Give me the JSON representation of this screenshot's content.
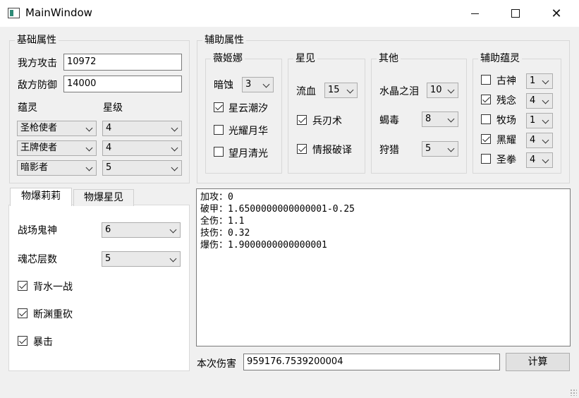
{
  "window": {
    "title": "MainWindow",
    "minimize": "",
    "maximize": "",
    "close": "✕"
  },
  "basic": {
    "title": "基础属性",
    "attack_label": "我方攻击",
    "attack_value": "10972",
    "defense_label": "敌方防御",
    "defense_value": "14000",
    "spirit_header": "蕴灵",
    "star_header": "星级",
    "spirits": [
      {
        "name": "圣枪使者",
        "star": "4"
      },
      {
        "name": "王牌使者",
        "star": "4"
      },
      {
        "name": "暗影者",
        "star": "5"
      }
    ]
  },
  "aux": {
    "title": "辅助属性",
    "weiji": {
      "title": "薇姬娜",
      "erosion_label": "暗蚀",
      "erosion_value": "3",
      "checks": [
        {
          "label": "星云潮汐",
          "checked": true
        },
        {
          "label": "光耀月华",
          "checked": false
        },
        {
          "label": "望月清光",
          "checked": false
        }
      ]
    },
    "xingjian": {
      "title": "星见",
      "bleed_label": "流血",
      "bleed_value": "15",
      "checks": [
        {
          "label": "兵刃术",
          "checked": true
        },
        {
          "label": "情报破译",
          "checked": true
        }
      ]
    },
    "other": {
      "title": "其他",
      "rows": [
        {
          "label": "水晶之泪",
          "value": "10"
        },
        {
          "label": "蝎毒",
          "value": "8"
        },
        {
          "label": "狩猎",
          "value": "5"
        }
      ]
    },
    "support": {
      "title": "辅助蕴灵",
      "rows": [
        {
          "label": "古神",
          "checked": false,
          "value": "1"
        },
        {
          "label": "残念",
          "checked": true,
          "value": "4"
        },
        {
          "label": "牧场",
          "checked": false,
          "value": "1"
        },
        {
          "label": "黑耀",
          "checked": true,
          "value": "4"
        },
        {
          "label": "圣拳",
          "checked": false,
          "value": "4"
        }
      ]
    }
  },
  "tabs": [
    {
      "label": "物爆莉莉"
    },
    {
      "label": "物爆星见"
    }
  ],
  "lili": {
    "battle_label": "战场鬼神",
    "battle_value": "6",
    "core_label": "魂芯层数",
    "core_value": "5",
    "checks": [
      {
        "label": "背水一战",
        "checked": true
      },
      {
        "label": "断渊重砍",
        "checked": true
      },
      {
        "label": "暴击",
        "checked": true
      }
    ]
  },
  "output": {
    "lines": [
      "加攻：0",
      "破甲：1.6500000000000001-0.25",
      "全伤：1.1",
      "技伤：0.32",
      "爆伤：1.9000000000000001"
    ]
  },
  "result": {
    "label": "本次伤害",
    "value": "959176.7539200004",
    "button": "计算"
  }
}
